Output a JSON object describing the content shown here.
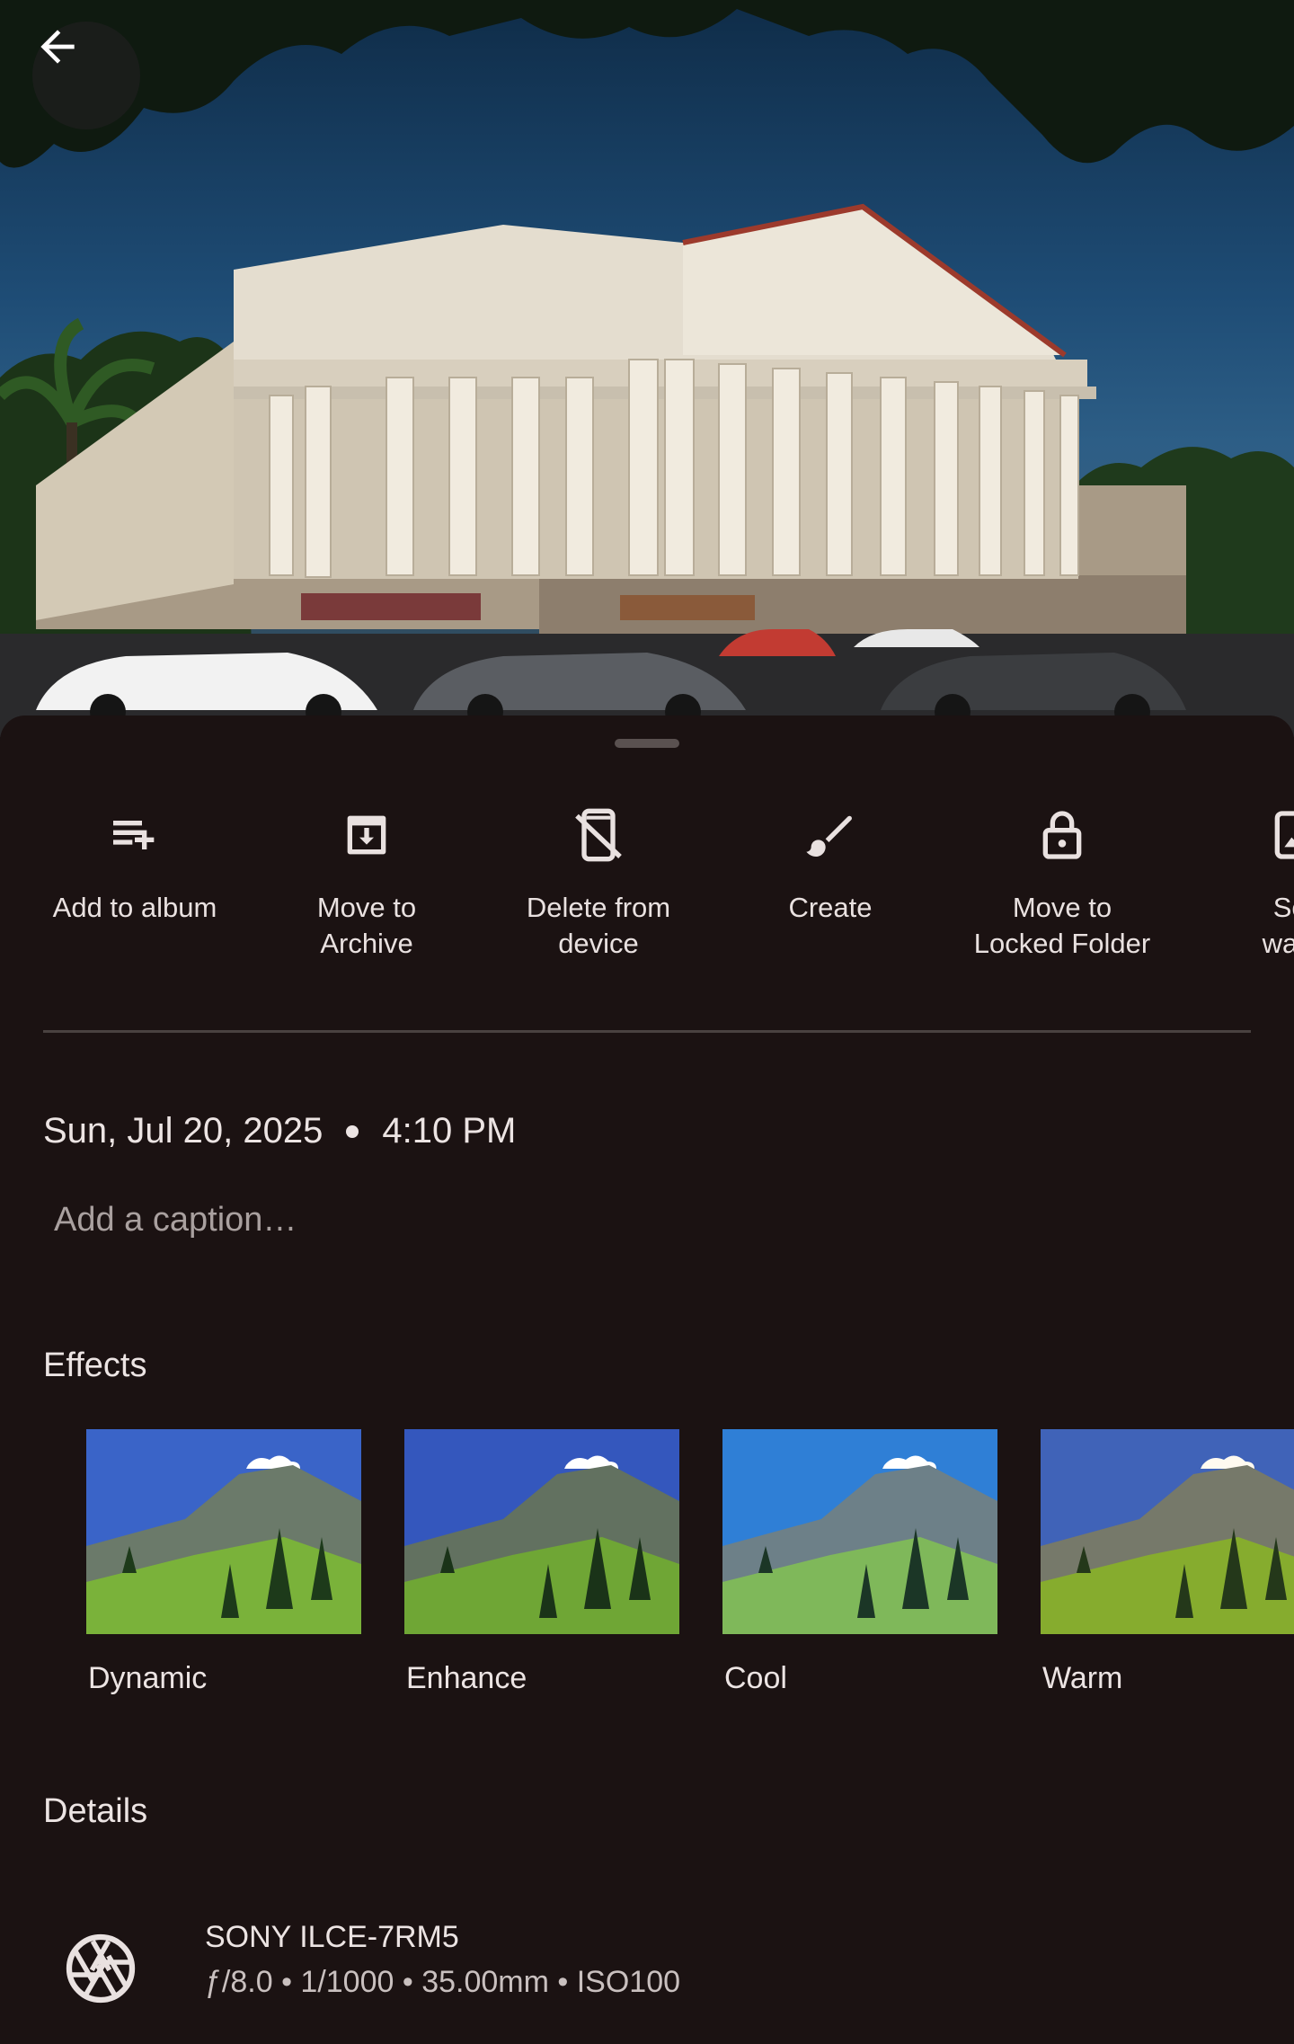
{
  "colors": {
    "background": "#1b1212",
    "text_primary": "#ece4e3",
    "text_secondary": "#a9a09f",
    "divider": "#4a4240"
  },
  "photo": {
    "back_icon": "arrow-left-icon"
  },
  "actions": [
    {
      "label": "Add to album",
      "icon": "playlist-add-icon"
    },
    {
      "label": "Move to\nArchive",
      "icon": "archive-icon"
    },
    {
      "label": "Delete from\ndevice",
      "icon": "mobile-off-icon"
    },
    {
      "label": "Create",
      "icon": "brush-icon"
    },
    {
      "label": "Move to\nLocked Folder",
      "icon": "lock-icon"
    },
    {
      "label": "Set\nwallp",
      "icon": "wallpaper-icon"
    }
  ],
  "info": {
    "date": "Sun, Jul 20, 2025",
    "time": "4:10 PM",
    "caption_placeholder": "Add a caption…"
  },
  "effects": {
    "title": "Effects",
    "items": [
      {
        "label": "Dynamic",
        "sky": "#3a64c8",
        "grass": "#7ab23a"
      },
      {
        "label": "Enhance",
        "sky": "#3457bd",
        "grass": "#6fa635"
      },
      {
        "label": "Cool",
        "sky": "#2f7fd6",
        "grass": "#7fb85a"
      },
      {
        "label": "Warm",
        "sky": "#4063b8",
        "grass": "#86ac2e"
      }
    ]
  },
  "details": {
    "title": "Details",
    "camera_icon": "aperture-icon",
    "camera_model": "SONY ILCE-7RM5",
    "camera_specs": "ƒ/8.0  •  1/1000  •  35.00mm  •  ISO100"
  }
}
